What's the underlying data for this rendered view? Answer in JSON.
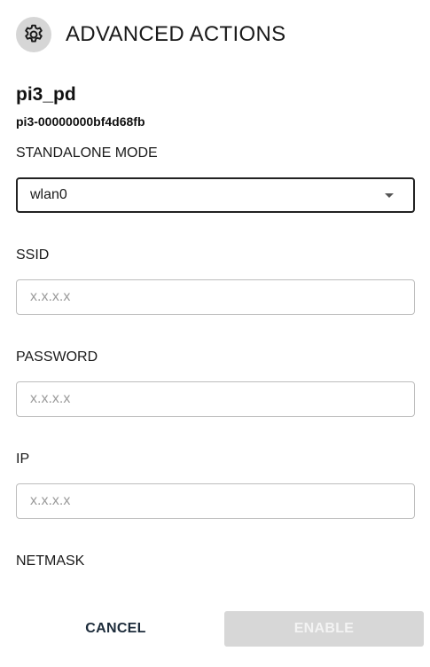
{
  "header": {
    "title": "ADVANCED ACTIONS",
    "icon": "gear-icon"
  },
  "device": {
    "name": "pi3_pd",
    "id": "pi3-00000000bf4d68fb"
  },
  "standalone_mode": {
    "label": "STANDALONE MODE",
    "selected": "wlan0"
  },
  "ssid": {
    "label": "SSID",
    "value": "",
    "placeholder": "x.x.x.x"
  },
  "password": {
    "label": "PASSWORD",
    "value": "",
    "placeholder": "x.x.x.x"
  },
  "ip": {
    "label": "IP",
    "value": "",
    "placeholder": "x.x.x.x"
  },
  "netmask": {
    "label": "NETMASK"
  },
  "actions": {
    "cancel_label": "CANCEL",
    "enable_label": "ENABLE",
    "enable_disabled": true
  },
  "colors": {
    "enable_bg_disabled": "#d7d7d7",
    "icon_bg": "#d6d6d6",
    "cancel_text": "#1c2b3a"
  }
}
